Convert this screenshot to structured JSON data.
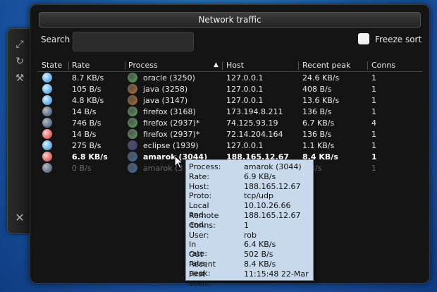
{
  "window": {
    "title": "Network traffic"
  },
  "toolbar": {
    "search_label": "Search",
    "search_value": "",
    "freeze_label": "Freeze sort"
  },
  "columns": [
    "State",
    "Rate",
    "Process",
    "Host",
    "Recent peak",
    "Conns"
  ],
  "rows": [
    {
      "rate": "8.7 KB/s",
      "process": "oracle (3250)",
      "host": "127.0.0.1",
      "peak": "24.6 KB/s",
      "conns": "1",
      "state": "blue",
      "proc": "oracle"
    },
    {
      "rate": "105 B/s",
      "process": "java (3258)",
      "host": "127.0.0.1",
      "peak": "408 B/s",
      "conns": "1",
      "state": "blue",
      "proc": "java"
    },
    {
      "rate": "4.8 KB/s",
      "process": "java (3147)",
      "host": "127.0.0.1",
      "peak": "13.6 KB/s",
      "conns": "1",
      "state": "blue",
      "proc": "java"
    },
    {
      "rate": "14 B/s",
      "process": "firefox (3168)",
      "host": "173.194.8.211",
      "peak": "136 B/s",
      "conns": "1",
      "state": "dark",
      "proc": "firefox"
    },
    {
      "rate": "746 B/s",
      "process": "firefox (2937)*",
      "host": "74.125.93.19",
      "peak": "6.7 KB/s",
      "conns": "4",
      "state": "dark",
      "proc": "firefox"
    },
    {
      "rate": "14 B/s",
      "process": "firefox (2937)*",
      "host": "72.14.204.164",
      "peak": "136 B/s",
      "conns": "1",
      "state": "red",
      "proc": "firefox"
    },
    {
      "rate": "275 B/s",
      "process": "eclipse (1939)",
      "host": "127.0.0.1",
      "peak": "1.1 KB/s",
      "conns": "1",
      "state": "blue",
      "proc": "eclipse"
    },
    {
      "rate": "6.8 KB/s",
      "process": "amarok (3044)",
      "host": "188.165.12.67",
      "peak": "8.4 KB/s",
      "conns": "1",
      "state": "red",
      "proc": "amarok",
      "style": "bold"
    },
    {
      "rate": "0 B/s",
      "process": "amarok (3",
      "host": "",
      "peak": "3 B/s",
      "conns": "1",
      "state": "dark",
      "proc": "amarok",
      "style": "dim"
    }
  ],
  "tooltip": [
    {
      "key": "Process:",
      "val": "amarok (3044)"
    },
    {
      "key": "Rate:",
      "val": "6.9 KB/s"
    },
    {
      "key": "Host:",
      "val": "188.165.12.67"
    },
    {
      "key": "Proto:",
      "val": "tcp/udp"
    },
    {
      "key": "Local end:",
      "val": "10.10.26.66"
    },
    {
      "key": "Remote end:",
      "val": "188.165.12.67"
    },
    {
      "key": "Conns:",
      "val": "1"
    },
    {
      "key": "User:",
      "val": "rob"
    },
    {
      "key": "In rate:",
      "val": "6.4 KB/s"
    },
    {
      "key": "Out rate:",
      "val": "502 B/s"
    },
    {
      "key": "Recent peak:",
      "val": "8.4 KB/s"
    },
    {
      "key": "First seen:",
      "val": "11:15:48 22-Mar"
    }
  ]
}
